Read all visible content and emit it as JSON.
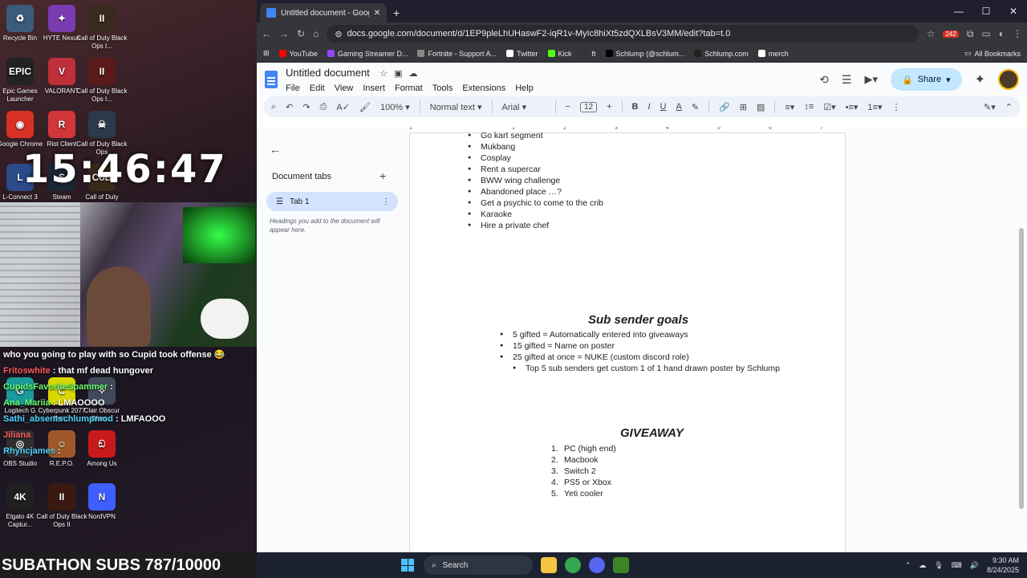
{
  "desktop": {
    "icons": [
      {
        "label": "Recycle Bin",
        "color": "#3b5b7a",
        "glyph": "♻"
      },
      {
        "label": "HYTE Nexus",
        "color": "#7a3bb0",
        "glyph": "✦"
      },
      {
        "label": "Call of Duty Black Ops I...",
        "color": "#3a2a1e",
        "glyph": "II"
      },
      {
        "label": "Epic Games Launcher",
        "color": "#222222",
        "glyph": "EPIC"
      },
      {
        "label": "VALORANT",
        "color": "#c0303a",
        "glyph": "V"
      },
      {
        "label": "Call of Duty Black Ops I...",
        "color": "#5a1a1a",
        "glyph": "II"
      },
      {
        "label": "Google Chrome",
        "color": "#d93025",
        "glyph": "◉"
      },
      {
        "label": "Riot Client",
        "color": "#d13639",
        "glyph": "R"
      },
      {
        "label": "Call of Duty Black Ops",
        "color": "#2a3a4a",
        "glyph": "☠"
      },
      {
        "label": "L-Connect 3",
        "color": "#2a4a8a",
        "glyph": "L"
      },
      {
        "label": "Steam",
        "color": "#1b2838",
        "glyph": "S"
      },
      {
        "label": "Call of Duty",
        "color": "#3a2a1a",
        "glyph": "CoD"
      },
      {
        "label": "Logitech G",
        "color": "#1a9a9a",
        "glyph": "G"
      },
      {
        "label": "Cyberpunk 2077 Bon...",
        "color": "#d8d800",
        "glyph": "C"
      },
      {
        "label": "Clair Obscur Glass...",
        "color": "#404a5a",
        "glyph": "✧"
      },
      {
        "label": "OBS Studio",
        "color": "#303030",
        "glyph": "◎"
      },
      {
        "label": "R.E.P.O.",
        "color": "#a0582a",
        "glyph": "☺"
      },
      {
        "label": "Among Us",
        "color": "#c81a1a",
        "glyph": "ඞ"
      },
      {
        "label": "Elgato 4K Captur...",
        "color": "#202020",
        "glyph": "4K"
      },
      {
        "label": "Call of Duty Black Ops II",
        "color": "#3a1a10",
        "glyph": "II"
      },
      {
        "label": "NordVPN",
        "color": "#3e5fff",
        "glyph": "N"
      }
    ],
    "clock": "15:46:47"
  },
  "chat": [
    {
      "user": "",
      "message": "who you going to play with so Cupid took offense 😂",
      "userColor": ""
    },
    {
      "user": "Fritoswhite",
      "message": ": that mf dead hungover",
      "userColor": "red"
    },
    {
      "user": "CupidsFavoriteSpammer",
      "message": ":",
      "userColor": "green"
    },
    {
      "user": "Ana_Mariia",
      "message": ": LMAOOOO",
      "userColor": "green"
    },
    {
      "user": "Sathi_absentschlumpmod",
      "message": ": LMFAOOO",
      "userColor": ""
    },
    {
      "user": "Jiliana",
      "message": "",
      "userColor": "red"
    },
    {
      "user": "Rhyncjames",
      "message": ":",
      "userColor": ""
    }
  ],
  "subathon": "SUBATHON SUBS 787/10000",
  "browser": {
    "tab_title": "Untitled document - Google Do",
    "url": "docs.google.com/document/d/1EP9pleLhUHaswF2-iqR1v-MyIc8hiXt5zdQXLBsV3MM/edit?tab=t.0",
    "bookmarks": [
      {
        "label": "YouTube",
        "color": "#ff0000"
      },
      {
        "label": "Gaming Streamer D...",
        "color": "#9146ff"
      },
      {
        "label": "Fortnite - Support A...",
        "color": "#888888"
      },
      {
        "label": "Twitter",
        "color": "#ffffff"
      },
      {
        "label": "Kick",
        "color": "#53fc18"
      },
      {
        "label": "ft",
        "color": "#333333"
      },
      {
        "label": "Schlump (@schlum...",
        "color": "#000000"
      },
      {
        "label": "Schlump.com",
        "color": "#222222"
      },
      {
        "label": "merch",
        "color": "#ffffff"
      }
    ],
    "all_bookmarks": "All Bookmarks",
    "extension_badge": "242"
  },
  "docs": {
    "title": "Untitled document",
    "menu": [
      "File",
      "Edit",
      "View",
      "Insert",
      "Format",
      "Tools",
      "Extensions",
      "Help"
    ],
    "share_label": "Share",
    "toolbar": {
      "zoom": "100%",
      "style": "Normal text",
      "font": "Arial",
      "font_size": "12",
      "bold": "B",
      "italic": "I",
      "underline": "U",
      "text_color": "A"
    },
    "sidepanel": {
      "title": "Document tabs",
      "tab_label": "Tab 1",
      "hint": "Headings you add to the document will appear here."
    },
    "ruler_marks": [
      "1",
      "1",
      "2",
      "3",
      "4",
      "5",
      "6",
      "7"
    ],
    "ideas": [
      "Go kart segment",
      "Mukbang",
      "Cosplay",
      "Rent a supercar",
      "BWW  wing challenge",
      "Abandoned place …?",
      "Get a psychic to come to the crib",
      "Karaoke",
      "Hire a private chef"
    ],
    "goals_heading": "Sub sender goals",
    "goals": [
      {
        "text": "5 gifted = Automatically entered into giveaways",
        "level": 1
      },
      {
        "text": "15 gifted = Name on poster",
        "level": 1
      },
      {
        "text": "25 gifted at once = NUKE (custom discord role)",
        "level": 1
      },
      {
        "text": "Top 5 sub senders get custom 1 of 1 hand drawn poster by Schlump",
        "level": 2
      }
    ],
    "giveaway_heading": "GIVEAWAY",
    "giveaway": [
      {
        "num": "1.",
        "text": "PC (high end)"
      },
      {
        "num": "2.",
        "text": "Macbook"
      },
      {
        "num": "3.",
        "text": "Switch 2"
      },
      {
        "num": "4.",
        "text": "PS5 or Xbox"
      },
      {
        "num": "5.",
        "text": "Yeti cooler"
      }
    ]
  },
  "taskbar": {
    "search_placeholder": "Search",
    "time": "9:30 AM",
    "date": "8/24/2025"
  }
}
